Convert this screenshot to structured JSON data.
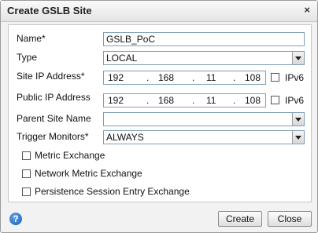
{
  "dialog": {
    "title": "Create GSLB Site",
    "close_icon": "×"
  },
  "form": {
    "name": {
      "label": "Name*",
      "value": "GSLB_PoC"
    },
    "type": {
      "label": "Type",
      "value": "LOCAL"
    },
    "site_ip": {
      "label": "Site IP Address*",
      "octets": [
        "192",
        "168",
        "11",
        "108"
      ],
      "ipv6_label": "IPv6",
      "ipv6_checked": false
    },
    "public_ip": {
      "label": "Public IP Address",
      "octets": [
        "192",
        "168",
        "11",
        "108"
      ],
      "ipv6_label": "IPv6",
      "ipv6_checked": false
    },
    "parent_site": {
      "label": "Parent Site Name",
      "value": ""
    },
    "trigger_monitors": {
      "label": "Trigger Monitors*",
      "value": "ALWAYS"
    },
    "checkboxes": [
      {
        "label": "Metric Exchange",
        "checked": false
      },
      {
        "label": "Network Metric Exchange",
        "checked": false
      },
      {
        "label": "Persistence Session Entry Exchange",
        "checked": false
      }
    ]
  },
  "footer": {
    "help_icon": "?",
    "create_label": "Create",
    "close_label": "Close"
  },
  "separator": "."
}
